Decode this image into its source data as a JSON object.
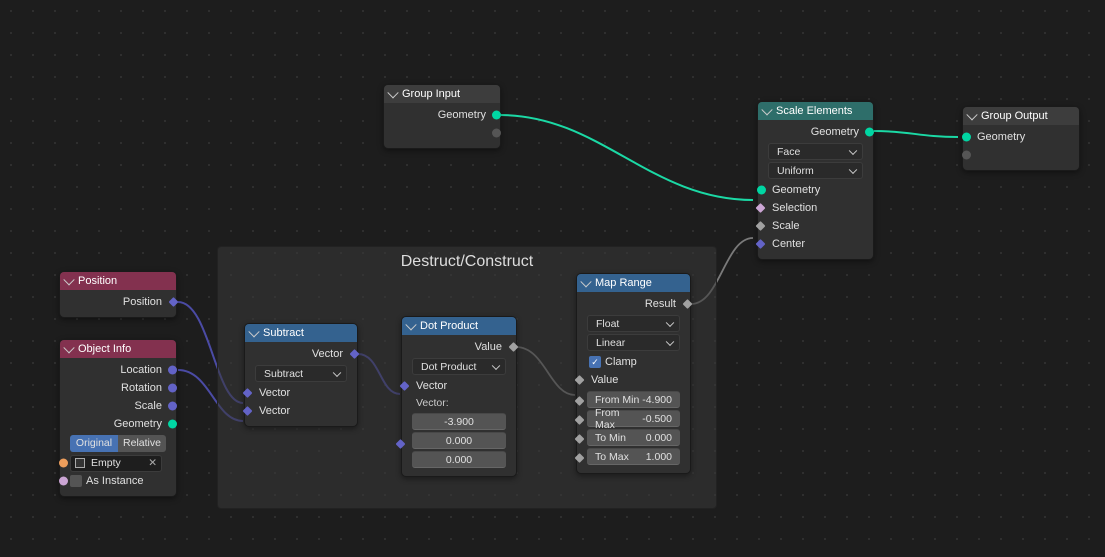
{
  "frame": {
    "title": "Destruct/Construct"
  },
  "group_input": {
    "title": "Group Input",
    "out_geometry": "Geometry"
  },
  "group_output": {
    "title": "Group Output",
    "in_geometry": "Geometry"
  },
  "scale_elements": {
    "title": "Scale Elements",
    "out_geometry": "Geometry",
    "domain": "Face",
    "mode": "Uniform",
    "in_geometry": "Geometry",
    "in_selection": "Selection",
    "in_scale": "Scale",
    "in_center": "Center"
  },
  "position": {
    "title": "Position",
    "out_position": "Position"
  },
  "object_info": {
    "title": "Object Info",
    "out_location": "Location",
    "out_rotation": "Rotation",
    "out_scale": "Scale",
    "out_geometry": "Geometry",
    "mode_original": "Original",
    "mode_relative": "Relative",
    "object_name": "Empty",
    "as_instance": "As Instance"
  },
  "subtract": {
    "title": "Subtract",
    "out_vector": "Vector",
    "op": "Subtract",
    "in_vector_a": "Vector",
    "in_vector_b": "Vector"
  },
  "dot_product": {
    "title": "Dot Product",
    "out_value": "Value",
    "op": "Dot Product",
    "in_vector": "Vector",
    "vector_label": "Vector:",
    "vx": "-3.900",
    "vy": "0.000",
    "vz": "0.000"
  },
  "map_range": {
    "title": "Map Range",
    "out_result": "Result",
    "dtype": "Float",
    "interp": "Linear",
    "clamp": "Clamp",
    "in_value": "Value",
    "from_min_l": "From Min",
    "from_min_v": "-4.900",
    "from_max_l": "From Max",
    "from_max_v": "-0.500",
    "to_min_l": "To Min",
    "to_min_v": "0.000",
    "to_max_l": "To Max",
    "to_max_v": "1.000"
  }
}
